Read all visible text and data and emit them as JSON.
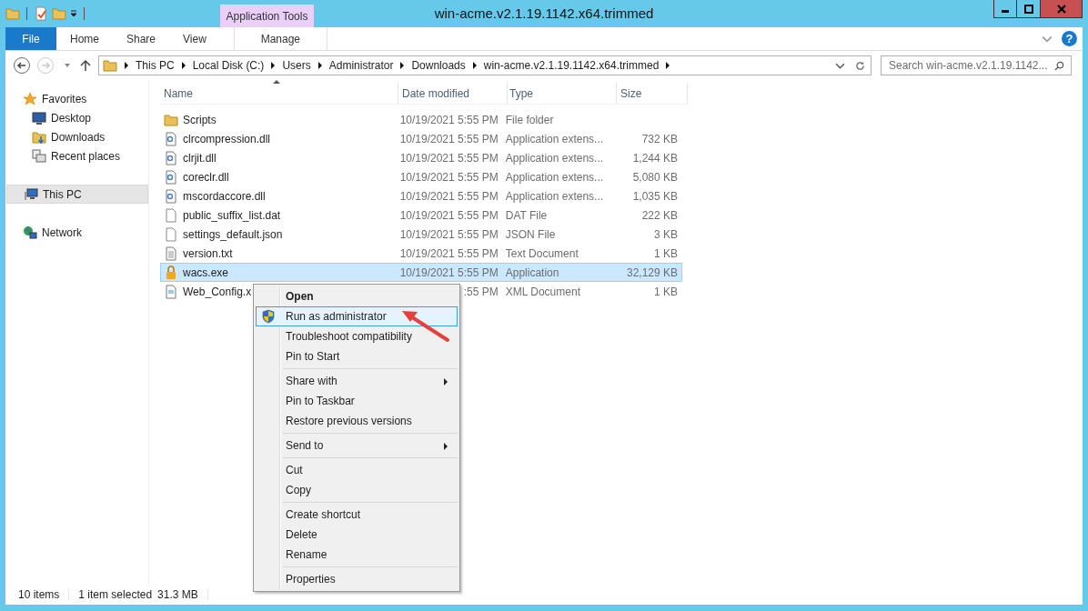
{
  "window": {
    "title": "win-acme.v2.1.19.1142.x64.trimmed"
  },
  "contextual_tab_group": "Application Tools",
  "ribbon_tabs": [
    {
      "label": "File",
      "kind": "file",
      "selected": false
    },
    {
      "label": "Home",
      "kind": "tab",
      "selected": false
    },
    {
      "label": "Share",
      "kind": "tab",
      "selected": false
    },
    {
      "label": "View",
      "kind": "tab",
      "selected": false
    },
    {
      "label": "Manage",
      "kind": "contextual",
      "selected": false
    }
  ],
  "help": "?",
  "breadcrumb": [
    "This PC",
    "Local Disk (C:)",
    "Users",
    "Administrator",
    "Downloads",
    "win-acme.v2.1.19.1142.x64.trimmed"
  ],
  "search": {
    "placeholder": "Search win-acme.v2.1.19.1142..."
  },
  "navigation": [
    {
      "label": "Favorites",
      "kind": "star",
      "selected": false,
      "children": [
        {
          "label": "Desktop",
          "kind": "desktop",
          "selected": false
        },
        {
          "label": "Downloads",
          "kind": "downloads",
          "selected": false
        },
        {
          "label": "Recent places",
          "kind": "recent",
          "selected": false
        }
      ]
    },
    {
      "label": "This PC",
      "kind": "pc",
      "selected": true
    },
    {
      "label": "Network",
      "kind": "network",
      "selected": false
    }
  ],
  "table": {
    "columns": [
      "Name",
      "Date modified",
      "Type",
      "Size"
    ],
    "rows": [
      {
        "kind": "folder",
        "name": "Scripts",
        "date": "10/19/2021 5:55 PM",
        "type": "File folder",
        "size": "",
        "selected": false
      },
      {
        "kind": "dll",
        "name": "clrcompression.dll",
        "date": "10/19/2021 5:55 PM",
        "type": "Application extens...",
        "size": "732 KB",
        "selected": false
      },
      {
        "kind": "dll",
        "name": "clrjit.dll",
        "date": "10/19/2021 5:55 PM",
        "type": "Application extens...",
        "size": "1,244 KB",
        "selected": false
      },
      {
        "kind": "dll",
        "name": "coreclr.dll",
        "date": "10/19/2021 5:55 PM",
        "type": "Application extens...",
        "size": "5,080 KB",
        "selected": false
      },
      {
        "kind": "dll",
        "name": "mscordaccore.dll",
        "date": "10/19/2021 5:55 PM",
        "type": "Application extens...",
        "size": "1,035 KB",
        "selected": false
      },
      {
        "kind": "blank",
        "name": "public_suffix_list.dat",
        "date": "10/19/2021 5:55 PM",
        "type": "DAT File",
        "size": "222 KB",
        "selected": false
      },
      {
        "kind": "blank",
        "name": "settings_default.json",
        "date": "10/19/2021 5:55 PM",
        "type": "JSON File",
        "size": "3 KB",
        "selected": false
      },
      {
        "kind": "text",
        "name": "version.txt",
        "date": "10/19/2021 5:55 PM",
        "type": "Text Document",
        "size": "1 KB",
        "selected": false
      },
      {
        "kind": "lock",
        "name": "wacs.exe",
        "date": "10/19/2021 5:55 PM",
        "type": "Application",
        "size": "32,129 KB",
        "selected": true
      },
      {
        "kind": "xml",
        "name": "Web_Config.x",
        "date": ":55 PM",
        "type": "XML Document",
        "size": "1 KB",
        "selected": false
      }
    ]
  },
  "context_menu": [
    [
      {
        "label": "Open",
        "default": true,
        "selected": false,
        "submenu": false
      },
      {
        "label": "Run as administrator",
        "default": false,
        "selected": true,
        "submenu": false,
        "kind": "shield"
      },
      {
        "label": "Troubleshoot compatibility",
        "default": false,
        "selected": false,
        "submenu": false
      },
      {
        "label": "Pin to Start",
        "default": false,
        "selected": false,
        "submenu": false
      }
    ],
    [
      {
        "label": "Share with",
        "default": false,
        "selected": false,
        "submenu": true
      },
      {
        "label": "Pin to Taskbar",
        "default": false,
        "selected": false,
        "submenu": false
      },
      {
        "label": "Restore previous versions",
        "default": false,
        "selected": false,
        "submenu": false
      }
    ],
    [
      {
        "label": "Send to",
        "default": false,
        "selected": false,
        "submenu": true
      }
    ],
    [
      {
        "label": "Cut",
        "default": false,
        "selected": false,
        "submenu": false
      },
      {
        "label": "Copy",
        "default": false,
        "selected": false,
        "submenu": false
      }
    ],
    [
      {
        "label": "Create shortcut",
        "default": false,
        "selected": false,
        "submenu": false
      },
      {
        "label": "Delete",
        "default": false,
        "selected": false,
        "submenu": false
      },
      {
        "label": "Rename",
        "default": false,
        "selected": false,
        "submenu": false
      }
    ],
    [
      {
        "label": "Properties",
        "default": false,
        "selected": false,
        "submenu": false
      }
    ]
  ],
  "status_bar": [
    "10 items",
    "1 item selected",
    "31.3 MB"
  ]
}
